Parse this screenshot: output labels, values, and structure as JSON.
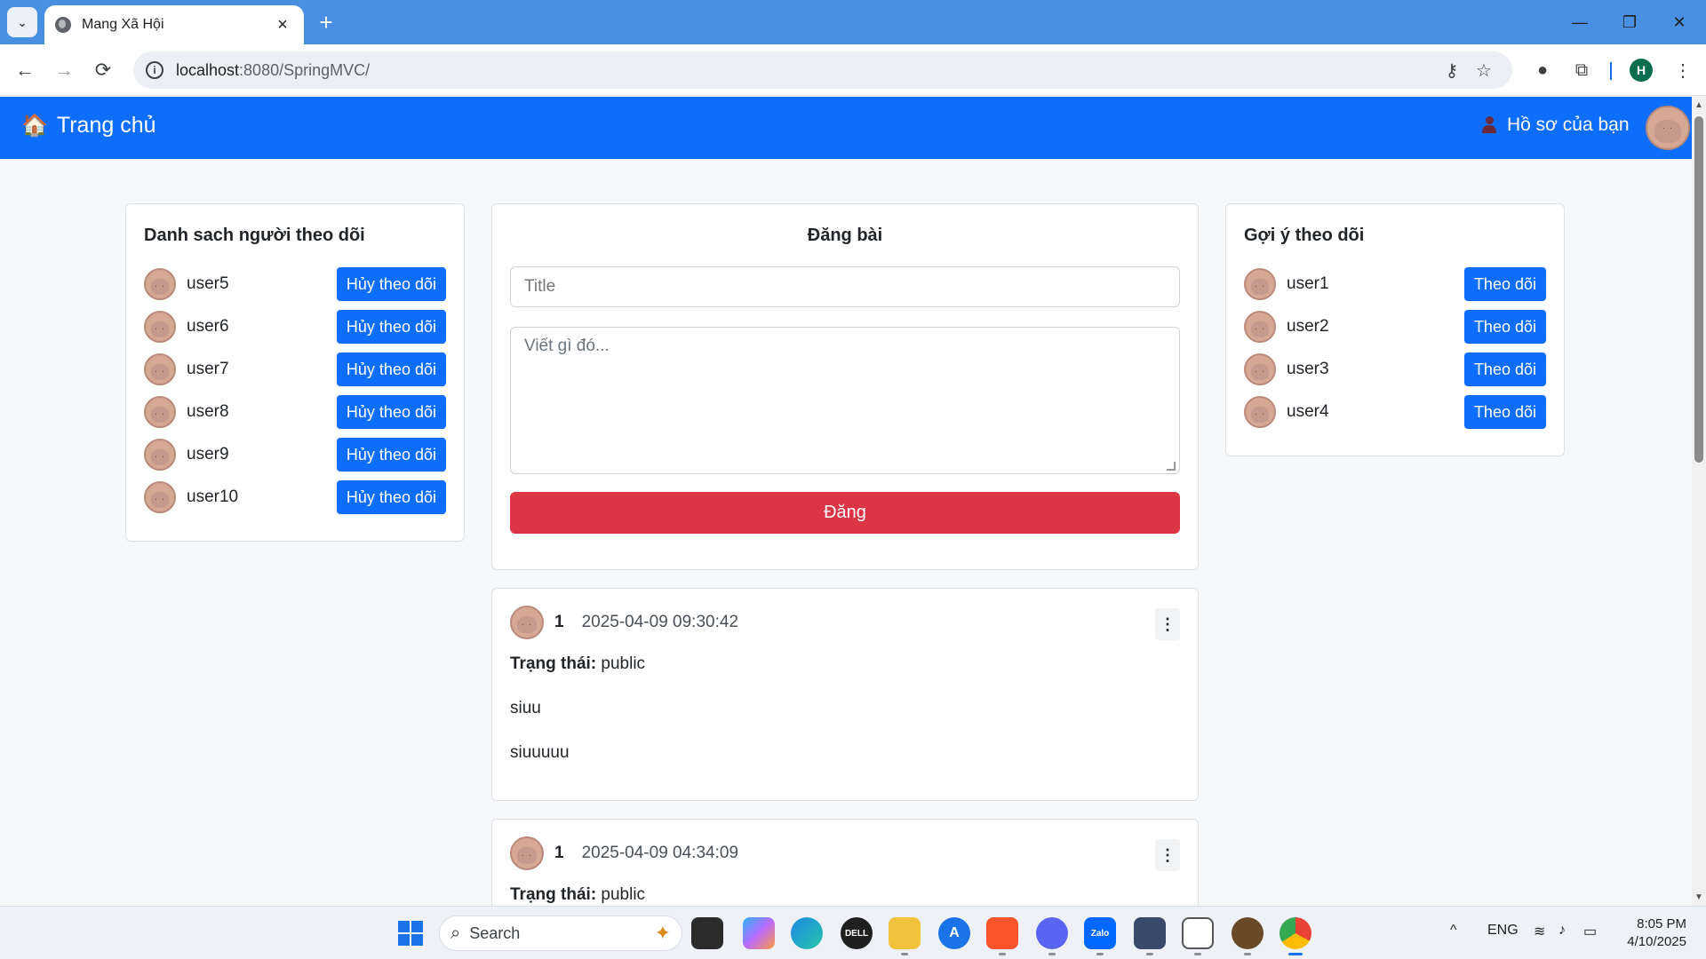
{
  "browser": {
    "tab_title": "Mang Xã Hội",
    "tab_close": "×",
    "new_tab": "+",
    "tab_menu": "⌄",
    "url_host": "localhost",
    "url_path": ":8080/SpringMVC/",
    "profile_initial": "H",
    "win_min": "—",
    "win_restore": "❐",
    "win_close": "✕",
    "back": "←",
    "forward": "→",
    "reload": "⟳"
  },
  "navbar": {
    "brand": "Trang chủ",
    "home_icon": "🏠",
    "profile_link": "Hồ sơ của bạn"
  },
  "following": {
    "title": "Danh sach người theo dõi",
    "users": [
      {
        "name": "user5",
        "action": "Hủy theo dõi"
      },
      {
        "name": "user6",
        "action": "Hủy theo dõi"
      },
      {
        "name": "user7",
        "action": "Hủy theo dõi"
      },
      {
        "name": "user8",
        "action": "Hủy theo dõi"
      },
      {
        "name": "user9",
        "action": "Hủy theo dõi"
      },
      {
        "name": "user10",
        "action": "Hủy theo dõi"
      }
    ]
  },
  "composer": {
    "title": "Đăng bài",
    "title_placeholder": "Title",
    "body_placeholder": "Viết gì đó...",
    "submit": "Đăng"
  },
  "suggestions": {
    "title": "Gợi ý theo dõi",
    "users": [
      {
        "name": "user1",
        "action": "Theo dõi"
      },
      {
        "name": "user2",
        "action": "Theo dõi"
      },
      {
        "name": "user3",
        "action": "Theo dõi"
      },
      {
        "name": "user4",
        "action": "Theo dõi"
      }
    ]
  },
  "posts": [
    {
      "author": "1",
      "time": "2025-04-09 09:30:42",
      "status_label": "Trạng thái:",
      "status": "public",
      "title": "siuu",
      "content": "siuuuuu",
      "menu": "⋮"
    },
    {
      "author": "1",
      "time": "2025-04-09 04:34:09",
      "status_label": "Trạng thái:",
      "status": "public",
      "menu": "⋮"
    }
  ],
  "taskbar": {
    "search": "Search",
    "lang": "ENG",
    "time": "8:05 PM",
    "date": "4/10/2025",
    "tray_chevron": "^"
  }
}
